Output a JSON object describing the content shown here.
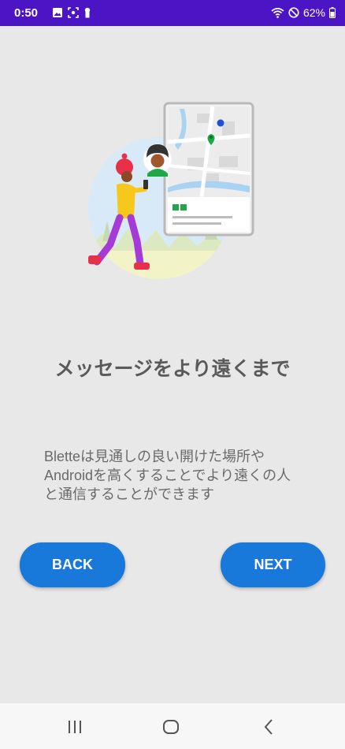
{
  "status_bar": {
    "time": "0:50",
    "battery": "62%",
    "left_icons": [
      "image-icon",
      "screenshot-icon",
      "keyhole-icon"
    ],
    "right_icons": [
      "wifi-icon",
      "do-not-disturb-icon",
      "battery-icon"
    ]
  },
  "onboarding": {
    "title": "メッセージをより遠くまで",
    "description_lines": [
      "Bletteは見通しの良い開けた場所や",
      "Androidを高くすることでより遠くの人",
      "と通信することができます"
    ],
    "back_label": "BACK",
    "next_label": "NEXT"
  },
  "nav_bar": {
    "buttons": [
      "recents-icon",
      "home-icon",
      "back-icon"
    ]
  },
  "colors": {
    "status_bar": "#4b14c4",
    "background": "#e8e8e8",
    "button": "#1979db",
    "title_text": "#5a5a5a",
    "body_text": "#6a6a6a"
  }
}
